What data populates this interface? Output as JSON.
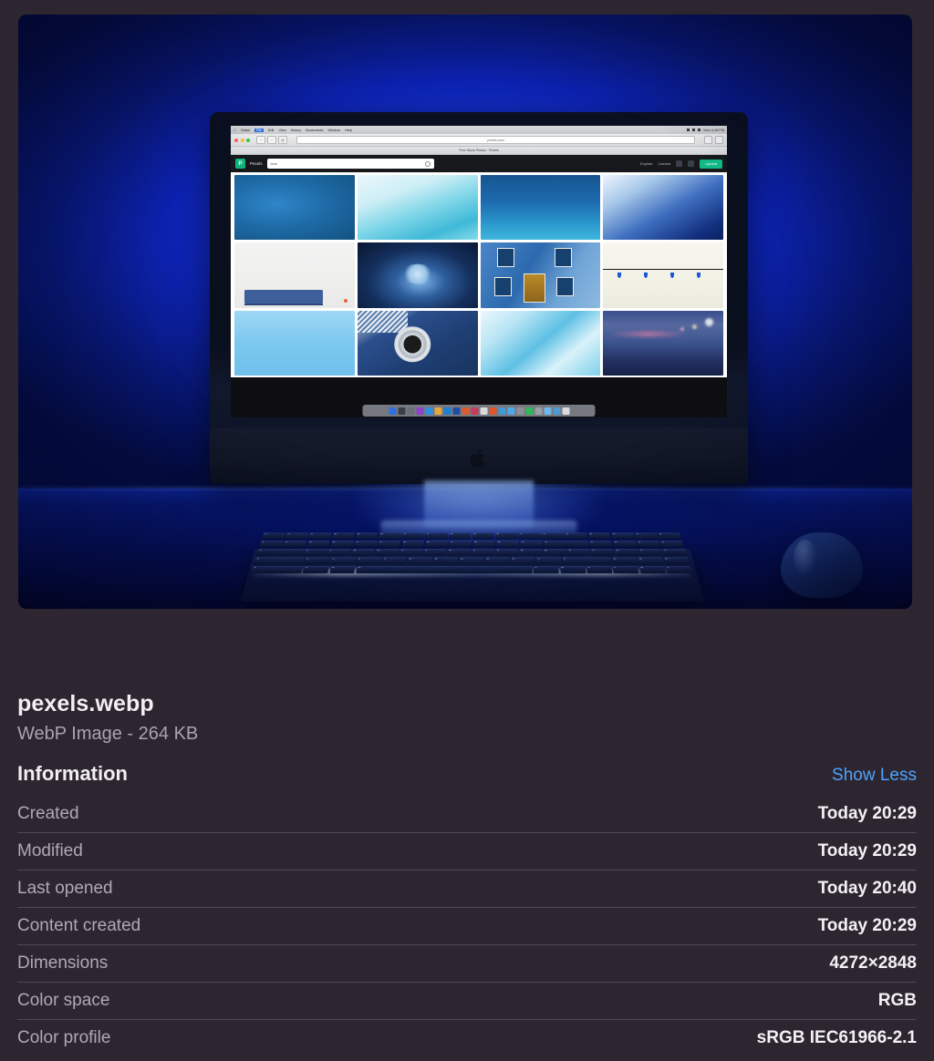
{
  "file": {
    "name": "pexels.webp",
    "meta": "WebP Image - 264 KB"
  },
  "section": {
    "title": "Information",
    "toggle_label": "Show Less"
  },
  "info_rows": [
    {
      "label": "Created",
      "value": "Today 20:29"
    },
    {
      "label": "Modified",
      "value": "Today 20:29"
    },
    {
      "label": "Last opened",
      "value": "Today 20:40"
    },
    {
      "label": "Content created",
      "value": "Today 20:29"
    },
    {
      "label": "Dimensions",
      "value": "4272×2848"
    },
    {
      "label": "Color space",
      "value": "RGB"
    },
    {
      "label": "Color profile",
      "value": "sRGB IEC61966-2.1"
    }
  ],
  "preview": {
    "alt": "Blue-lit iMac desktop with mechanical keyboard and mouse",
    "browser": {
      "menu_items": [
        "Safari",
        "File",
        "Edit",
        "View",
        "History",
        "Bookmarks",
        "Window",
        "Help"
      ],
      "active_menu": "File",
      "menubar_status": "Mon 4:18 PM",
      "url": "pexels.com",
      "tab_title": "Free Stock Photos · Pexels",
      "site_name": "Pexels",
      "search_value": "blue",
      "nav_links": [
        "Explore",
        "License"
      ],
      "cta_label": "Upload"
    }
  },
  "colors": {
    "background": "#2d2630",
    "accent_link": "#4da3ff",
    "label_text": "#b0a8b6",
    "value_text": "#f4f1f6",
    "photo_blue": "#1232d8",
    "cta_green": "#12b886"
  }
}
